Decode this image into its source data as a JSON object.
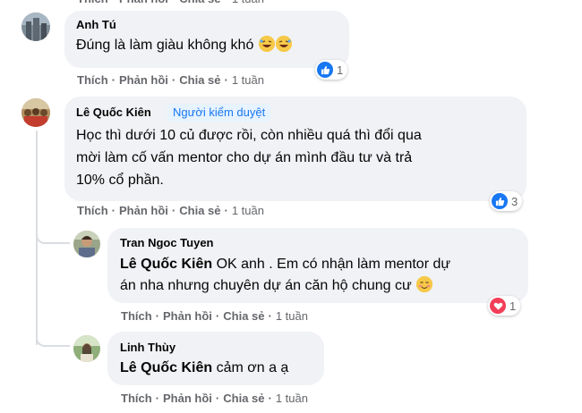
{
  "comments": [
    {
      "author": "Anh Tú",
      "text": "Đúng là làm giàu không khó",
      "actions": {
        "like": "Thích",
        "reply": "Phản hồi",
        "share": "Chia sẻ",
        "time": "1 tuần"
      },
      "reaction": {
        "type": "like",
        "count": "1"
      }
    },
    {
      "author": "Lê Quốc Kiên",
      "badge": "Người kiểm duyệt",
      "lines": [
        "Học thì dưới 10 củ được rồi, còn nhiều quá thì đổi qua",
        "mời làm cố vấn mentor cho dự án mình đầu tư và trả",
        "10% cổ phần."
      ],
      "actions": {
        "like": "Thích",
        "reply": "Phản hồi",
        "share": "Chia sẻ",
        "time": "1 tuần"
      },
      "reaction": {
        "type": "like",
        "count": "3"
      }
    }
  ],
  "replies": [
    {
      "author": "Tran Ngoc Tuyen",
      "mention": "Lê Quốc Kiên",
      "line1_rest": " OK anh . Em có nhận làm mentor dự",
      "line2": "án nha nhưng chuyên dự án căn hộ chung cư",
      "actions": {
        "like": "Thích",
        "reply": "Phản hồi",
        "share": "Chia sẻ",
        "time": "1 tuần"
      },
      "reaction": {
        "type": "love",
        "count": "1"
      }
    },
    {
      "author": "Linh Thùy",
      "mention": "Lê Quốc Kiên",
      "rest": " cảm ơn a ạ",
      "actions": {
        "like": "Thích",
        "reply": "Phản hồi",
        "share": "Chia sẻ",
        "time": "1 tuần"
      }
    }
  ],
  "colors": {
    "like_blue": "#1877f2",
    "love_red": "#f33e58",
    "bubble": "#f0f2f5",
    "meta": "#65676b"
  }
}
